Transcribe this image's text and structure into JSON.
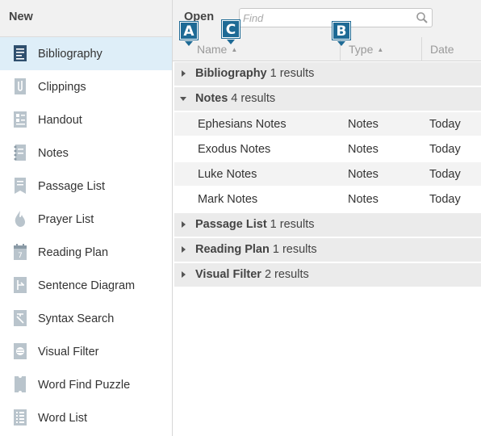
{
  "left_panel": {
    "title": "New",
    "items": [
      {
        "label": "Bibliography",
        "icon": "bibliography-icon",
        "selected": true
      },
      {
        "label": "Clippings",
        "icon": "paperclip-icon",
        "selected": false
      },
      {
        "label": "Handout",
        "icon": "handout-icon",
        "selected": false
      },
      {
        "label": "Notes",
        "icon": "notes-icon",
        "selected": false
      },
      {
        "label": "Passage List",
        "icon": "passage-list-icon",
        "selected": false
      },
      {
        "label": "Prayer List",
        "icon": "prayer-flame-icon",
        "selected": false
      },
      {
        "label": "Reading Plan",
        "icon": "calendar-icon",
        "selected": false
      },
      {
        "label": "Sentence Diagram",
        "icon": "sentence-diagram-icon",
        "selected": false
      },
      {
        "label": "Syntax Search",
        "icon": "syntax-search-icon",
        "selected": false
      },
      {
        "label": "Visual Filter",
        "icon": "visual-filter-icon",
        "selected": false
      },
      {
        "label": "Word Find Puzzle",
        "icon": "puzzle-icon",
        "selected": false
      },
      {
        "label": "Word List",
        "icon": "word-list-icon",
        "selected": false
      }
    ]
  },
  "right_panel": {
    "title": "Open",
    "search": {
      "placeholder": "Find",
      "value": ""
    },
    "columns": {
      "name": "Name",
      "type": "Type",
      "date": "Date"
    },
    "groups": [
      {
        "name": "Bibliography",
        "count": "1 results",
        "expanded": false,
        "rows": []
      },
      {
        "name": "Notes",
        "count": "4 results",
        "expanded": true,
        "rows": [
          {
            "name": "Ephesians Notes",
            "type": "Notes",
            "date": "Today"
          },
          {
            "name": "Exodus Notes",
            "type": "Notes",
            "date": "Today"
          },
          {
            "name": "Luke Notes",
            "type": "Notes",
            "date": "Today"
          },
          {
            "name": "Mark Notes",
            "type": "Notes",
            "date": "Today"
          }
        ]
      },
      {
        "name": "Passage List",
        "count": "1 results",
        "expanded": false,
        "rows": []
      },
      {
        "name": "Reading Plan",
        "count": "1 results",
        "expanded": false,
        "rows": []
      },
      {
        "name": "Visual Filter",
        "count": "2 results",
        "expanded": false,
        "rows": []
      }
    ]
  },
  "callouts": {
    "a": "A",
    "b": "B",
    "c": "C"
  },
  "colors": {
    "accent": "#1e6a95",
    "selected_bg": "#deeef8",
    "header_bg": "#f1f1f1",
    "group_bg": "#ebebeb",
    "icon": "#8a9aa6"
  }
}
